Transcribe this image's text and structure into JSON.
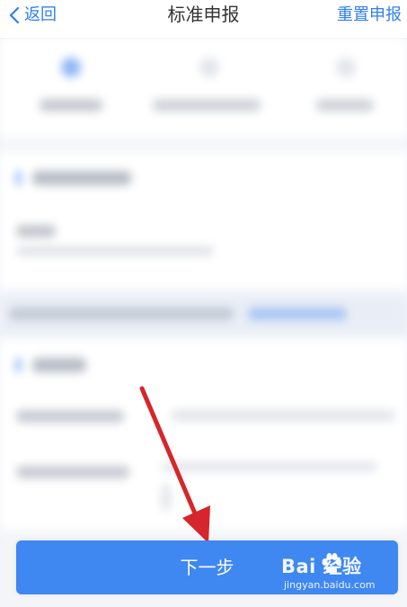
{
  "header": {
    "back_label": "返回",
    "title": "标准申报",
    "reset_label": "重置申报"
  },
  "footer": {
    "next_label": "下一步"
  },
  "watermark": {
    "brand": "Bai  经验",
    "url": "jingyan.baidu.com"
  },
  "colors": {
    "accent": "#3f87f1",
    "link": "#2f7ff2",
    "annotation_arrow": "#d6262b"
  },
  "icons": {
    "back": "chevron-left-icon",
    "watermark": "paw-icon"
  }
}
